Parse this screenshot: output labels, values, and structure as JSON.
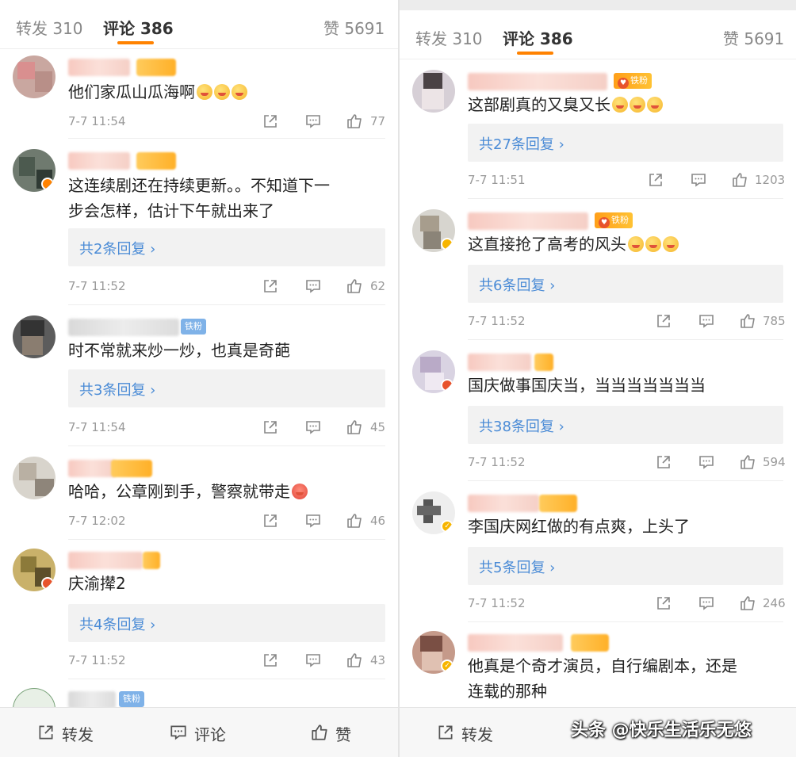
{
  "left": {
    "tabs": {
      "repost": "转发 310",
      "comments": "评论 386",
      "likes": "赞 5691"
    },
    "comments": [
      {
        "text": "他们家瓜山瓜海啊",
        "time": "7-7 11:54",
        "likes": "77"
      },
      {
        "text_line1": "这连续剧还在持续更新。。不知道下一",
        "text_line2": "步会怎样，估计下午就出来了",
        "replies": "共2条回复 ›",
        "time": "7-7 11:52",
        "likes": "62"
      },
      {
        "badge": "铁粉",
        "text": "时不常就来炒一炒，也真是奇葩",
        "replies": "共3条回复 ›",
        "time": "7-7 11:54",
        "likes": "45"
      },
      {
        "text": "哈哈，公章刚到手，警察就带走",
        "time": "7-7 12:02",
        "likes": "46"
      },
      {
        "text": "庆渝撵2",
        "replies": "共4条回复 ›",
        "time": "7-7 11:52",
        "likes": "43"
      },
      {
        "badge": "铁粉"
      }
    ],
    "bottom": {
      "repost": "转发",
      "comment": "评论",
      "like": "赞"
    }
  },
  "right": {
    "tabs": {
      "repost": "转发 310",
      "comments": "评论 386",
      "likes": "赞 5691"
    },
    "comments": [
      {
        "badge": "铁粉",
        "text": "这部剧真的又臭又长",
        "replies": "共27条回复 ›",
        "time": "7-7 11:51",
        "likes": "1203"
      },
      {
        "badge": "铁粉",
        "text": "这直接抢了高考的风头",
        "replies": "共6条回复 ›",
        "time": "7-7 11:52",
        "likes": "785"
      },
      {
        "text": "国庆做事国庆当，当当当当当当当",
        "replies": "共38条回复 ›",
        "time": "7-7 11:52",
        "likes": "594"
      },
      {
        "text": "李国庆网红做的有点爽，上头了",
        "replies": "共5条回复 ›",
        "time": "7-7 11:52",
        "likes": "246"
      },
      {
        "text_line1": "他真是个奇才演员，自行编剧本，还是",
        "text_line2": "连载的那种"
      }
    ],
    "bottom": {
      "repost": "转发"
    }
  },
  "watermark": "头条 @快乐生活乐无悠",
  "colors": {
    "accent": "#ff8200",
    "link": "#4a8bd6",
    "muted": "#999999"
  }
}
